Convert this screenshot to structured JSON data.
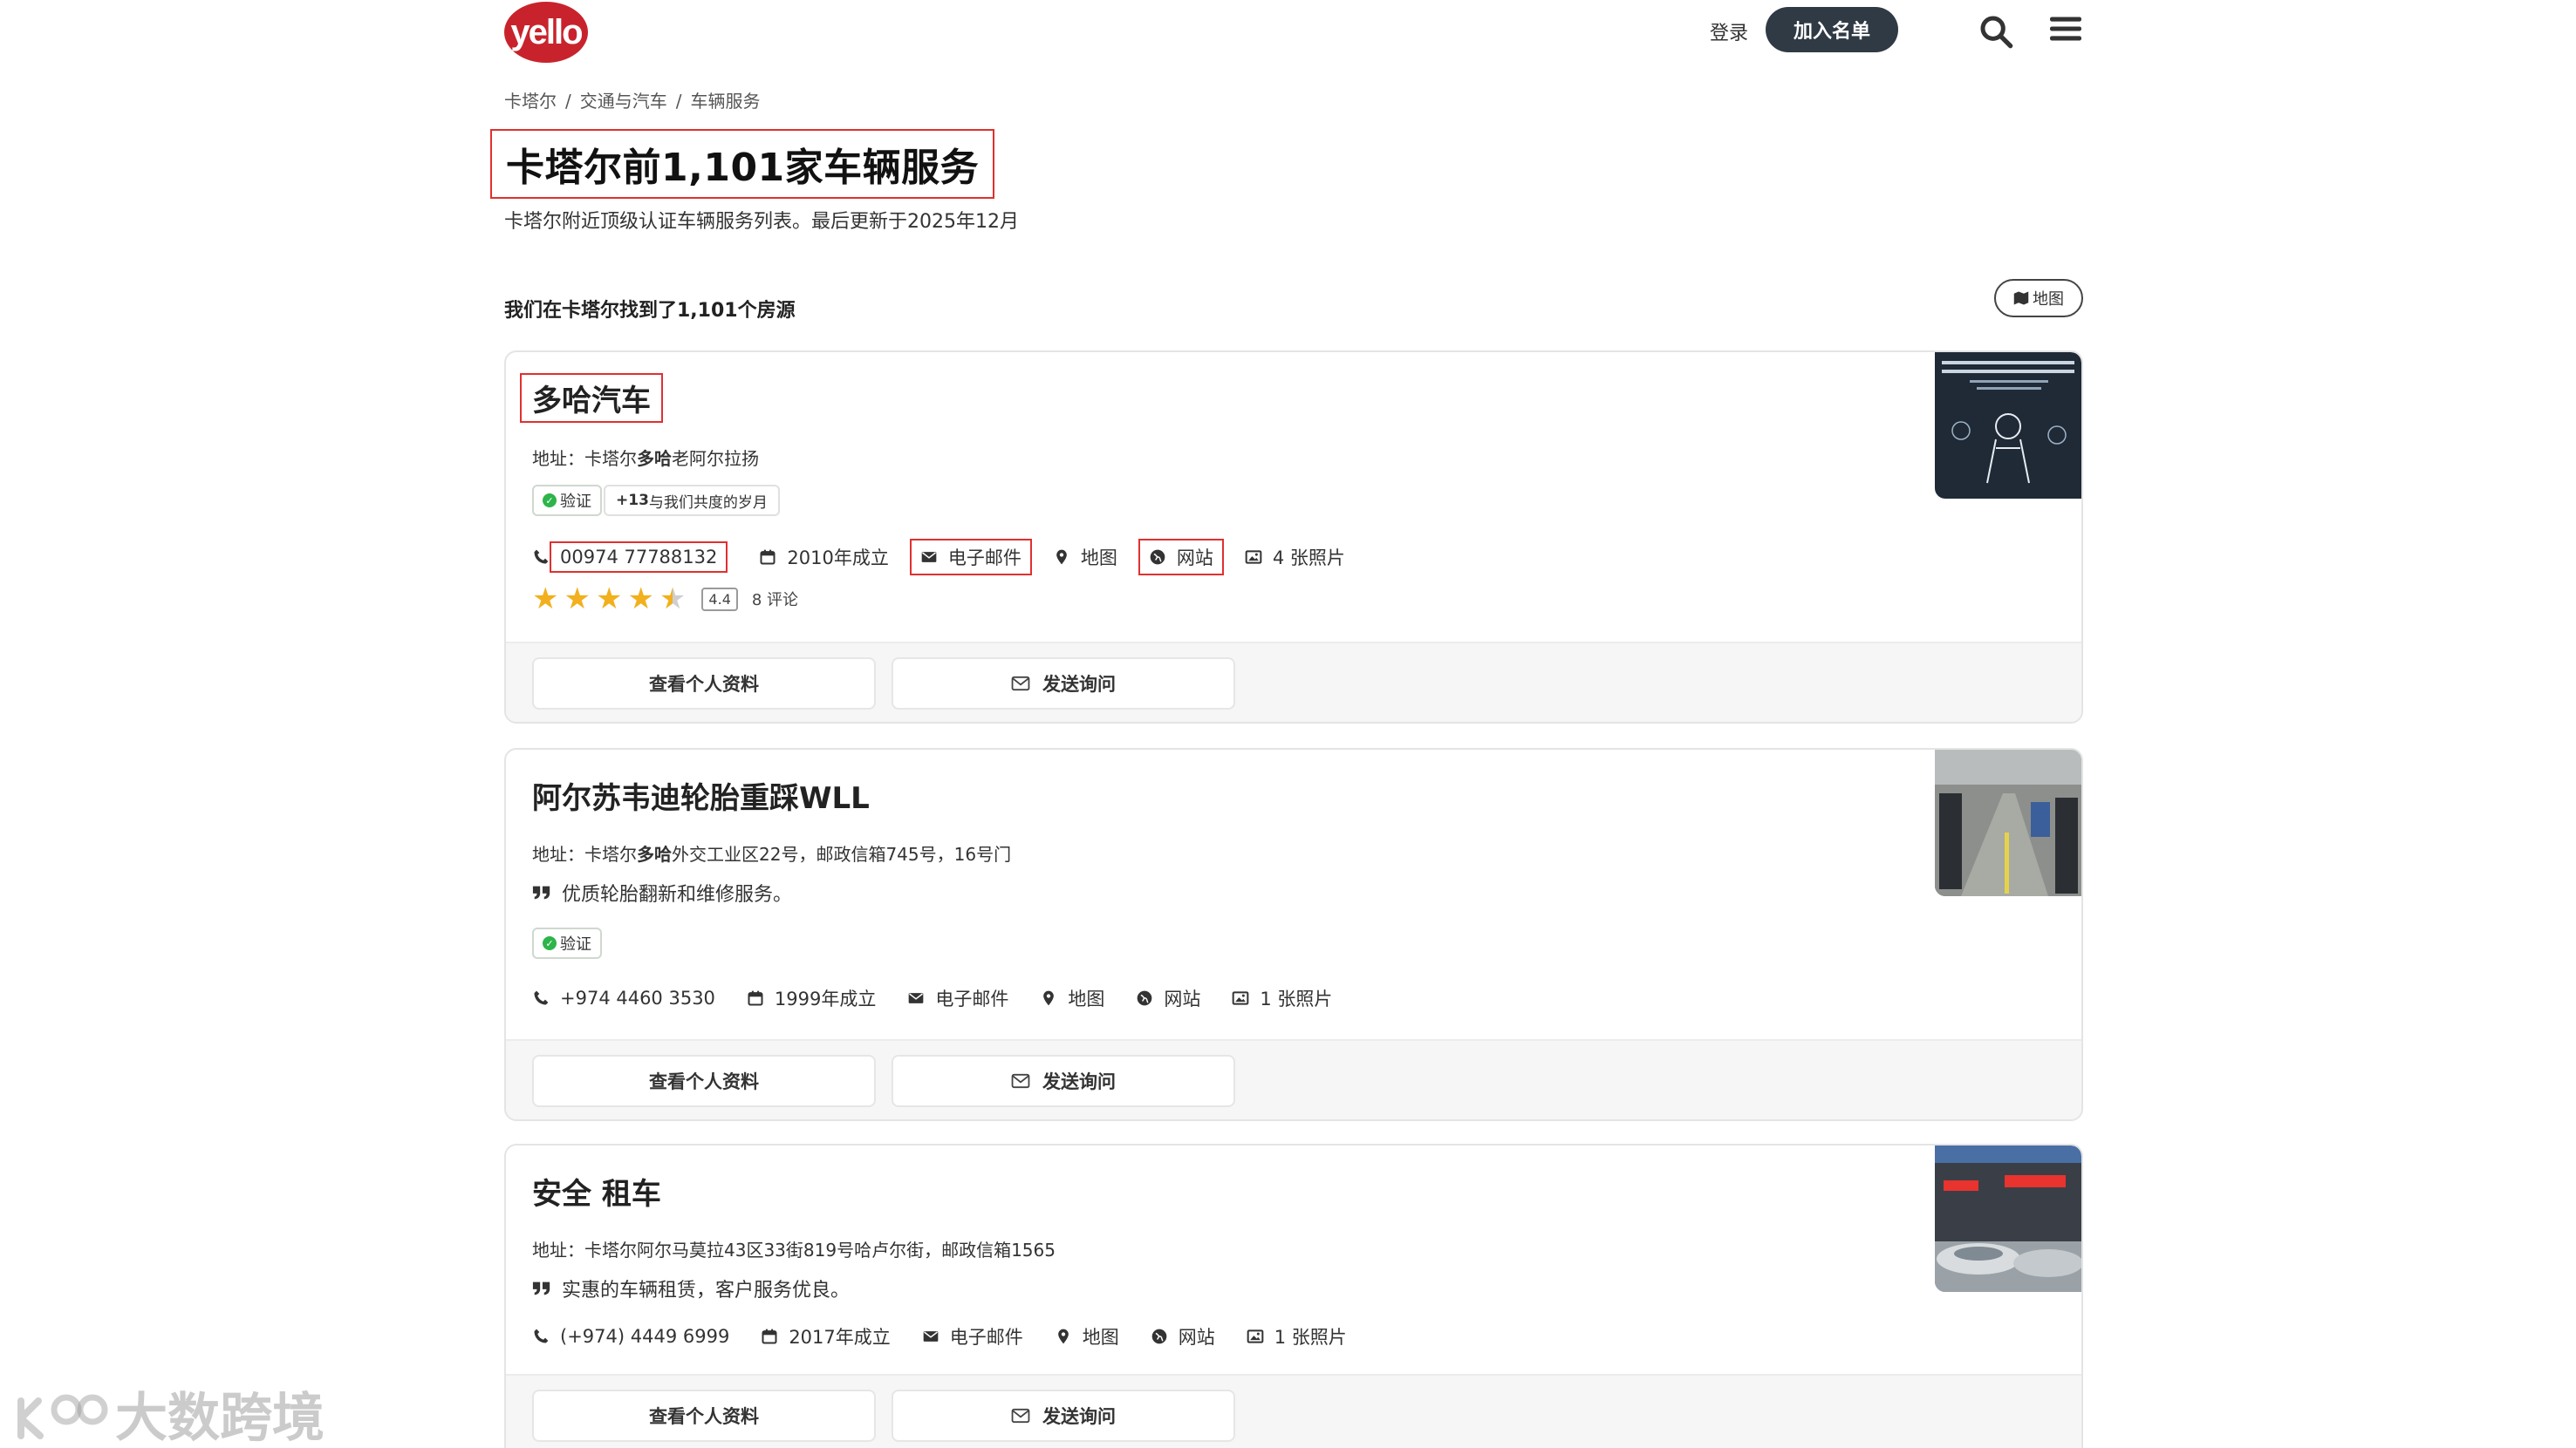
{
  "header": {
    "logo": "yello",
    "login": "登录",
    "join": "加入名单"
  },
  "breadcrumb": [
    "卡塔尔",
    "交通与汽车",
    "车辆服务"
  ],
  "title": "卡塔尔前1,101家车辆服务",
  "subtitle": "卡塔尔附近顶级认证车辆服务列表。最后更新于2025年12月",
  "found": "我们在卡塔尔找到了1,101个房源",
  "map_button": "地图",
  "listings": [
    {
      "name": "多哈汽车",
      "address_prefix": "地址：卡塔尔",
      "address_bold": "多哈",
      "address_rest": "老阿尔拉扬",
      "verified": "验证",
      "years_badge_bold": "+13",
      "years_badge_rest": "与我们共度的岁月",
      "phone": "00974 77788132",
      "established": "2010年成立",
      "email": "电子邮件",
      "map": "地图",
      "website": "网站",
      "photos": "4 张照片",
      "rating": "4.4",
      "reviews": "8 评论",
      "profile": "查看个人资料",
      "inquiry": "发送询问"
    },
    {
      "name": "阿尔苏韦迪轮胎重踩WLL",
      "address_prefix": "地址：卡塔尔",
      "address_bold": "多哈",
      "address_rest": "外交工业区22号，邮政信箱745号，16号门",
      "quote": "优质轮胎翻新和维修服务。",
      "verified": "验证",
      "phone": "+974 4460 3530",
      "established": "1999年成立",
      "email": "电子邮件",
      "map": "地图",
      "website": "网站",
      "photos": "1 张照片",
      "profile": "查看个人资料",
      "inquiry": "发送询问"
    },
    {
      "name": "安全 租车",
      "address_prefix": "地址：卡塔尔阿尔马莫拉43区33街819号哈卢尔街，邮政信箱1565",
      "quote": "实惠的车辆租赁，客户服务优良。",
      "phone": "(+974) 4449 6999",
      "established": "2017年成立",
      "email": "电子邮件",
      "map": "地图",
      "website": "网站",
      "photos": "1 张照片",
      "profile": "查看个人资料",
      "inquiry": "发送询问"
    }
  ],
  "watermark": "大数跨境",
  "colors": {
    "brand": "#c8232c",
    "dark_button": "#2f3a45",
    "star": "#f2b01e",
    "verified": "#2db44a",
    "highlight_box": "#e03030"
  }
}
